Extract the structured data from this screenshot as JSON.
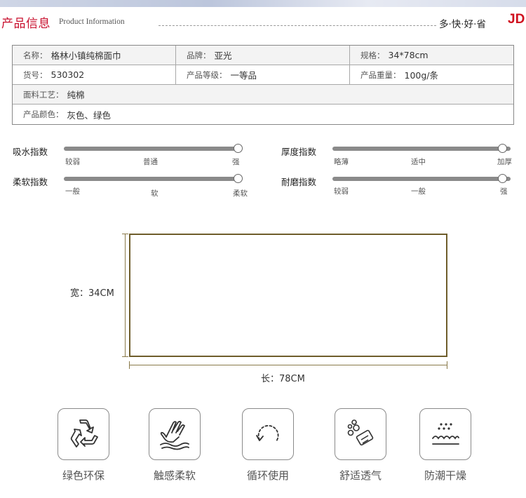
{
  "header": {
    "title": "产品信息",
    "subtitle": "Product Information",
    "slogan": "多·快·好·省",
    "logo": "JD"
  },
  "spec": {
    "rows": [
      [
        {
          "label": "名称：",
          "value": "格林小镇纯棉面巾"
        },
        {
          "label": "品牌：",
          "value": "亚光"
        },
        {
          "label": "规格：",
          "value": "34*78cm"
        }
      ],
      [
        {
          "label": "货号：",
          "value": "530302"
        },
        {
          "label": "产品等级：",
          "value": "一等品"
        },
        {
          "label": "产品重量：",
          "value": "100g/条"
        }
      ],
      [
        {
          "label": "面料工艺：",
          "value": "纯棉"
        }
      ],
      [
        {
          "label": "产品颜色：",
          "value": "灰色、绿色"
        }
      ]
    ]
  },
  "indices": [
    {
      "name": "吸水指数",
      "ticks": [
        "较弱",
        "普通",
        "强"
      ],
      "level": 1.0
    },
    {
      "name": "厚度指数",
      "ticks": [
        "略薄",
        "适中",
        "加厚"
      ],
      "level": 1.0
    },
    {
      "name": "柔软指数",
      "ticks": [
        "一般",
        "软",
        "柔软"
      ],
      "level": 1.0
    },
    {
      "name": "耐磨指数",
      "ticks": [
        "较弱",
        "一般",
        "强"
      ],
      "level": 1.0
    }
  ],
  "dimensions": {
    "width_label": "宽：34CM",
    "length_label": "长：78CM"
  },
  "features": [
    {
      "label": "绿色环保",
      "icon": "recycle-icon"
    },
    {
      "label": "触感柔软",
      "icon": "hand-touch-icon"
    },
    {
      "label": "循环使用",
      "icon": "cycle-arrow-icon"
    },
    {
      "label": "舒适透气",
      "icon": "bubbles-soap-icon"
    },
    {
      "label": "防潮干燥",
      "icon": "dry-waves-icon"
    }
  ],
  "colors": {
    "accent": "#c8102e",
    "logo": "#d0101e",
    "box_border": "#6e5d2b",
    "track": "#8a8a8a"
  }
}
